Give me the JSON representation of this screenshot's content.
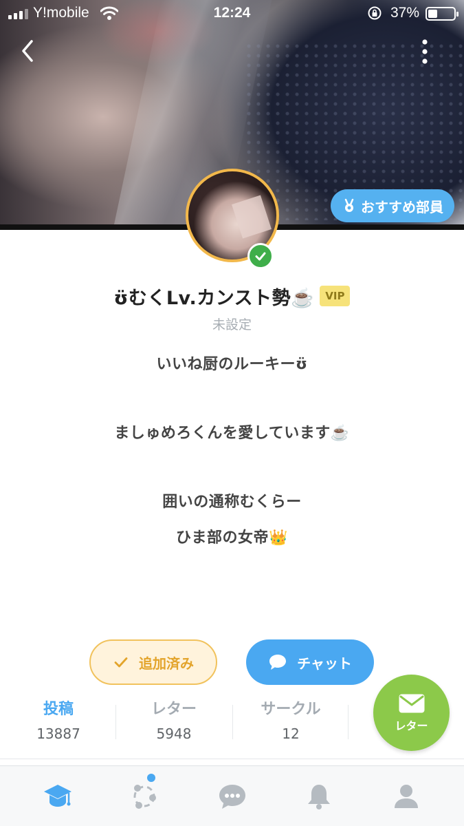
{
  "status_bar": {
    "carrier": "Y!mobile",
    "time": "12:24",
    "battery": "37%",
    "battery_level": 0.37
  },
  "header": {
    "recommend_badge": "おすすめ部員"
  },
  "profile": {
    "name": "ʊ̈むくLv.カンスト勢☕️",
    "vip_label": "VIP",
    "subtitle": "未設定",
    "verified": true,
    "bio_lines": [
      "いいね厨のルーキーʊ̈",
      "ましゅめろくんを愛しています☕️",
      "囲いの通称むくらー",
      "ひま部の女帝👑"
    ]
  },
  "actions": {
    "added_label": "追加済み",
    "chat_label": "チャット"
  },
  "stats": [
    {
      "label": "投稿",
      "value": "13887",
      "active": true
    },
    {
      "label": "レター",
      "value": "5948",
      "active": false
    },
    {
      "label": "サークル",
      "value": "12",
      "active": false
    }
  ],
  "fab": {
    "letter_label": "レター"
  },
  "tabs": [
    {
      "icon": "graduation-cap-icon",
      "active": true
    },
    {
      "icon": "circle-network-icon",
      "active": false,
      "badge": true
    },
    {
      "icon": "chat-bubble-icon",
      "active": false
    },
    {
      "icon": "bell-icon",
      "active": false
    },
    {
      "icon": "person-icon",
      "active": false
    }
  ],
  "colors": {
    "accent_blue": "#4aa8f1",
    "badge_blue": "#55b1f0",
    "added_orange": "#e3a42b",
    "added_bg": "#fff3dc",
    "fab_green": "#8cc94a",
    "verified_green": "#3fae4a",
    "vip_yellow": "#f6e27a",
    "inactive_icon": "#b5bbc1"
  }
}
